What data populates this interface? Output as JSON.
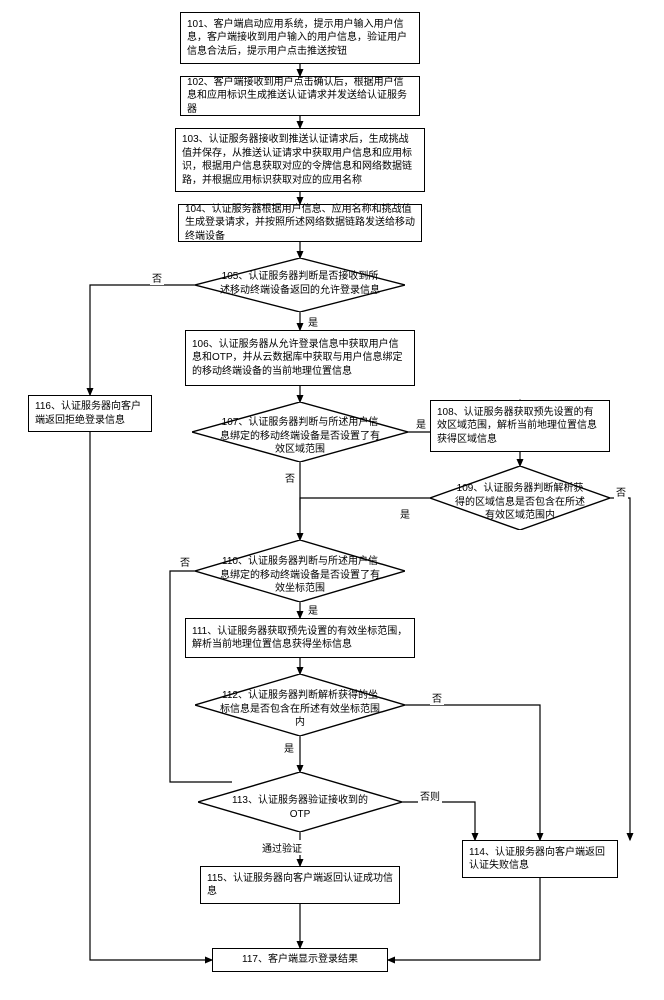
{
  "chart_data": {
    "type": "flowchart",
    "title": "推送认证与地理位置校验登录流程",
    "nodes": [
      {
        "id": "101",
        "type": "process",
        "text": "101、客户端启动应用系统，提示用户输入用户信息，客户端接收到用户输入的用户信息，验证用户信息合法后，提示用户点击推送按钮"
      },
      {
        "id": "102",
        "type": "process",
        "text": "102、客户端接收到用户点击确认后，根据用户信息和应用标识生成推送认证请求并发送给认证服务器"
      },
      {
        "id": "103",
        "type": "process",
        "text": "103、认证服务器接收到推送认证请求后，生成挑战值并保存，从推送认证请求中获取用户信息和应用标识，根据用户信息获取对应的令牌信息和网络数据链路，并根据应用标识获取对应的应用名称"
      },
      {
        "id": "104",
        "type": "process",
        "text": "104、认证服务器根据用户信息、应用名称和挑战值生成登录请求，并按照所述网络数据链路发送给移动终端设备"
      },
      {
        "id": "105",
        "type": "decision",
        "text": "105、认证服务器判断是否接收到所述移动终端设备返回的允许登录信息"
      },
      {
        "id": "106",
        "type": "process",
        "text": "106、认证服务器从允许登录信息中获取用户信息和OTP，并从云数据库中获取与用户信息绑定的移动终端设备的当前地理位置信息"
      },
      {
        "id": "107",
        "type": "decision",
        "text": "107、认证服务器判断与所述用户信息绑定的移动终端设备是否设置了有效区域范围"
      },
      {
        "id": "108",
        "type": "process",
        "text": "108、认证服务器获取预先设置的有效区域范围，解析当前地理位置信息获得区域信息"
      },
      {
        "id": "109",
        "type": "decision",
        "text": "109、认证服务器判断解析获得的区域信息是否包含在所述有效区域范围内"
      },
      {
        "id": "110",
        "type": "decision",
        "text": "110、认证服务器判断与所述用户信息绑定的移动终端设备是否设置了有效坐标范围"
      },
      {
        "id": "111",
        "type": "process",
        "text": "111、认证服务器获取预先设置的有效坐标范围，解析当前地理位置信息获得坐标信息"
      },
      {
        "id": "112",
        "type": "decision",
        "text": "112、认证服务器判断解析获得的坐标信息是否包含在所述有效坐标范围内"
      },
      {
        "id": "113",
        "type": "decision",
        "text": "113、认证服务器验证接收到的OTP"
      },
      {
        "id": "114",
        "type": "process",
        "text": "114、认证服务器向客户端返回认证失败信息"
      },
      {
        "id": "115",
        "type": "process",
        "text": "115、认证服务器向客户端返回认证成功信息"
      },
      {
        "id": "116",
        "type": "process",
        "text": "116、认证服务器向客户端返回拒绝登录信息"
      },
      {
        "id": "117",
        "type": "process",
        "text": "117、客户端显示登录结果"
      }
    ],
    "edges": [
      {
        "from": "101",
        "to": "102"
      },
      {
        "from": "102",
        "to": "103"
      },
      {
        "from": "103",
        "to": "104"
      },
      {
        "from": "104",
        "to": "105"
      },
      {
        "from": "105",
        "to": "106",
        "label": "是"
      },
      {
        "from": "105",
        "to": "116",
        "label": "否"
      },
      {
        "from": "106",
        "to": "107"
      },
      {
        "from": "107",
        "to": "108",
        "label": "是"
      },
      {
        "from": "107",
        "to": "110",
        "label": "否"
      },
      {
        "from": "108",
        "to": "109"
      },
      {
        "from": "109",
        "to": "110",
        "label": "是"
      },
      {
        "from": "109",
        "to": "114",
        "label": "否"
      },
      {
        "from": "110",
        "to": "111",
        "label": "是"
      },
      {
        "from": "110",
        "to": "113",
        "label": "否"
      },
      {
        "from": "111",
        "to": "112"
      },
      {
        "from": "112",
        "to": "113",
        "label": "是"
      },
      {
        "from": "112",
        "to": "114",
        "label": "否"
      },
      {
        "from": "113",
        "to": "115",
        "label": "通过验证"
      },
      {
        "from": "113",
        "to": "114",
        "label": "否则"
      },
      {
        "from": "114",
        "to": "117"
      },
      {
        "from": "115",
        "to": "117"
      },
      {
        "from": "116",
        "to": "117"
      }
    ],
    "labels": {
      "yes": "是",
      "no": "否",
      "pass": "通过验证",
      "else": "否则"
    }
  }
}
